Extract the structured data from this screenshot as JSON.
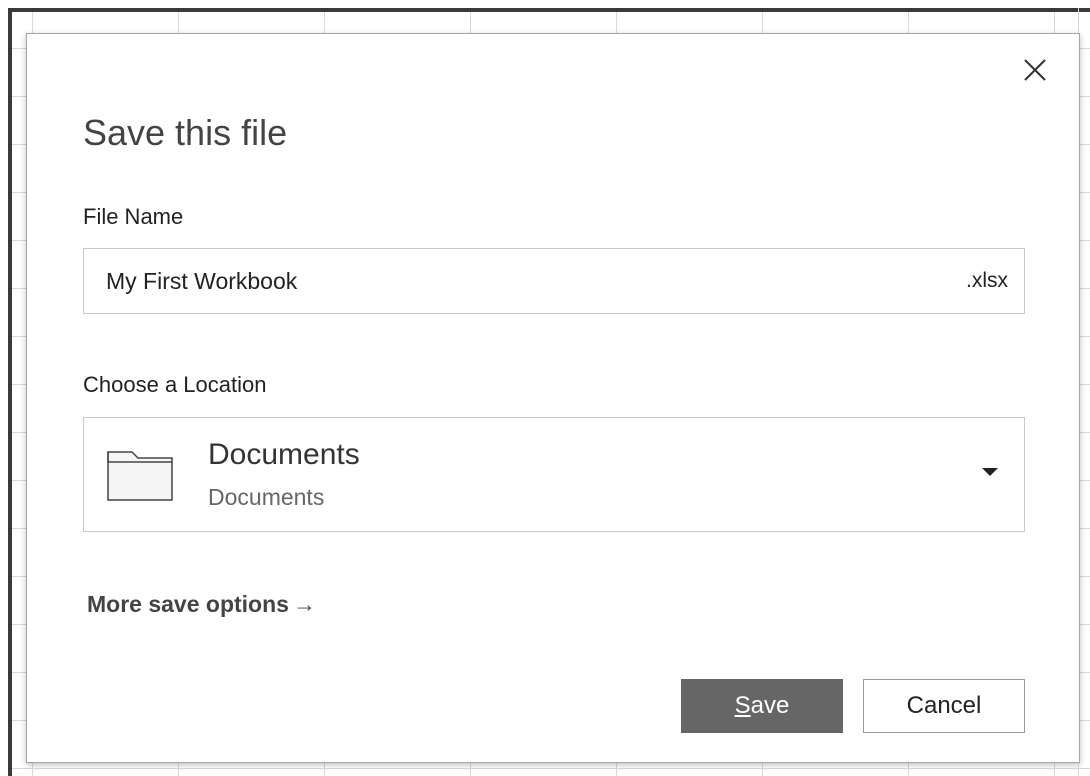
{
  "dialog": {
    "title": "Save this file",
    "close_icon": "close-icon",
    "file_name_label": "File Name",
    "file_name_value": "My First Workbook",
    "file_extension": ".xlsx",
    "location_label": "Choose a Location",
    "location": {
      "icon": "folder-icon",
      "name": "Documents",
      "path": "Documents",
      "dropdown_icon": "chevron-down-icon"
    },
    "more_options_label": "More save options",
    "more_options_arrow": "→",
    "save_button": {
      "mnemonic": "S",
      "rest": "ave"
    },
    "cancel_label": "Cancel"
  },
  "colors": {
    "save_button_bg": "#666666",
    "title_text": "#444444",
    "border": "#c8c8c8"
  }
}
